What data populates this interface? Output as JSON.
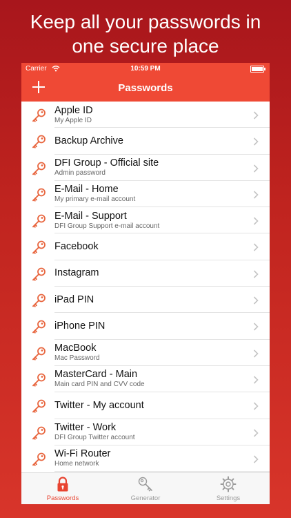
{
  "promo": {
    "headline_line1": "Keep all your passwords in",
    "headline_line2": "one secure place"
  },
  "statusbar": {
    "carrier": "Carrier",
    "time": "10:59 PM"
  },
  "navbar": {
    "title": "Passwords"
  },
  "items": [
    {
      "title": "Apple ID",
      "subtitle": "My Apple ID"
    },
    {
      "title": "Backup Archive",
      "subtitle": ""
    },
    {
      "title": "DFI Group - Official site",
      "subtitle": "Admin password"
    },
    {
      "title": "E-Mail - Home",
      "subtitle": "My primary e-mail account"
    },
    {
      "title": "E-Mail - Support",
      "subtitle": "DFI Group Support e-mail account"
    },
    {
      "title": "Facebook",
      "subtitle": ""
    },
    {
      "title": "Instagram",
      "subtitle": ""
    },
    {
      "title": "iPad PIN",
      "subtitle": ""
    },
    {
      "title": "iPhone PIN",
      "subtitle": ""
    },
    {
      "title": "MacBook",
      "subtitle": "Mac Password"
    },
    {
      "title": "MasterCard - Main",
      "subtitle": "Main card PIN and CVV code"
    },
    {
      "title": "Twitter - My account",
      "subtitle": ""
    },
    {
      "title": "Twitter - Work",
      "subtitle": "DFI Group Twitter account"
    },
    {
      "title": "Wi-Fi Router",
      "subtitle": "Home network"
    }
  ],
  "tabs": [
    {
      "label": "Passwords",
      "icon": "lock-icon",
      "active": true
    },
    {
      "label": "Generator",
      "icon": "key-icon",
      "active": false
    },
    {
      "label": "Settings",
      "icon": "gear-icon",
      "active": false
    }
  ],
  "colors": {
    "accent": "#ef4935",
    "background_top": "#a8161c",
    "background_bottom": "#d8352a",
    "key_icon": "#e8663f"
  }
}
